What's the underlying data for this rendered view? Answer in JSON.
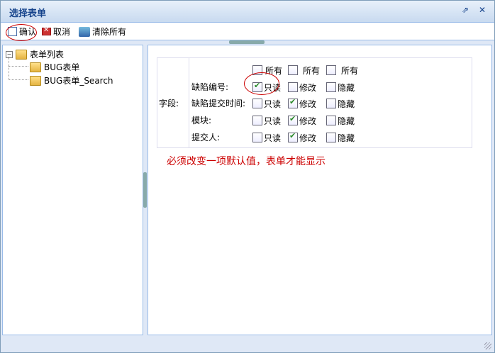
{
  "window": {
    "title": "选择表单"
  },
  "toolbar": {
    "confirm_label": "确认",
    "cancel_label": "取消",
    "clear_label": "清除所有"
  },
  "tree": {
    "root": "表单列表",
    "items": [
      "BUG表单",
      "BUG表单_Search"
    ]
  },
  "form": {
    "field_label": "字段:",
    "header": [
      "所有",
      "所有",
      "所有"
    ],
    "rows": [
      {
        "label": "缺陷编号:",
        "readonly": true,
        "modify": false,
        "hidden": false
      },
      {
        "label": "缺陷提交时间:",
        "readonly": false,
        "modify": true,
        "hidden": false
      },
      {
        "label": "模块:",
        "readonly": false,
        "modify": true,
        "hidden": false
      },
      {
        "label": "提交人:",
        "readonly": false,
        "modify": true,
        "hidden": false
      }
    ],
    "option_readonly": "只读",
    "option_modify": "修改",
    "option_hidden": "隐藏"
  },
  "notice": "必须改变一项默认值，表单才能显示",
  "colors": {
    "notice": "#cc0000",
    "annotation": "#cc0000",
    "title": "#15428b"
  }
}
